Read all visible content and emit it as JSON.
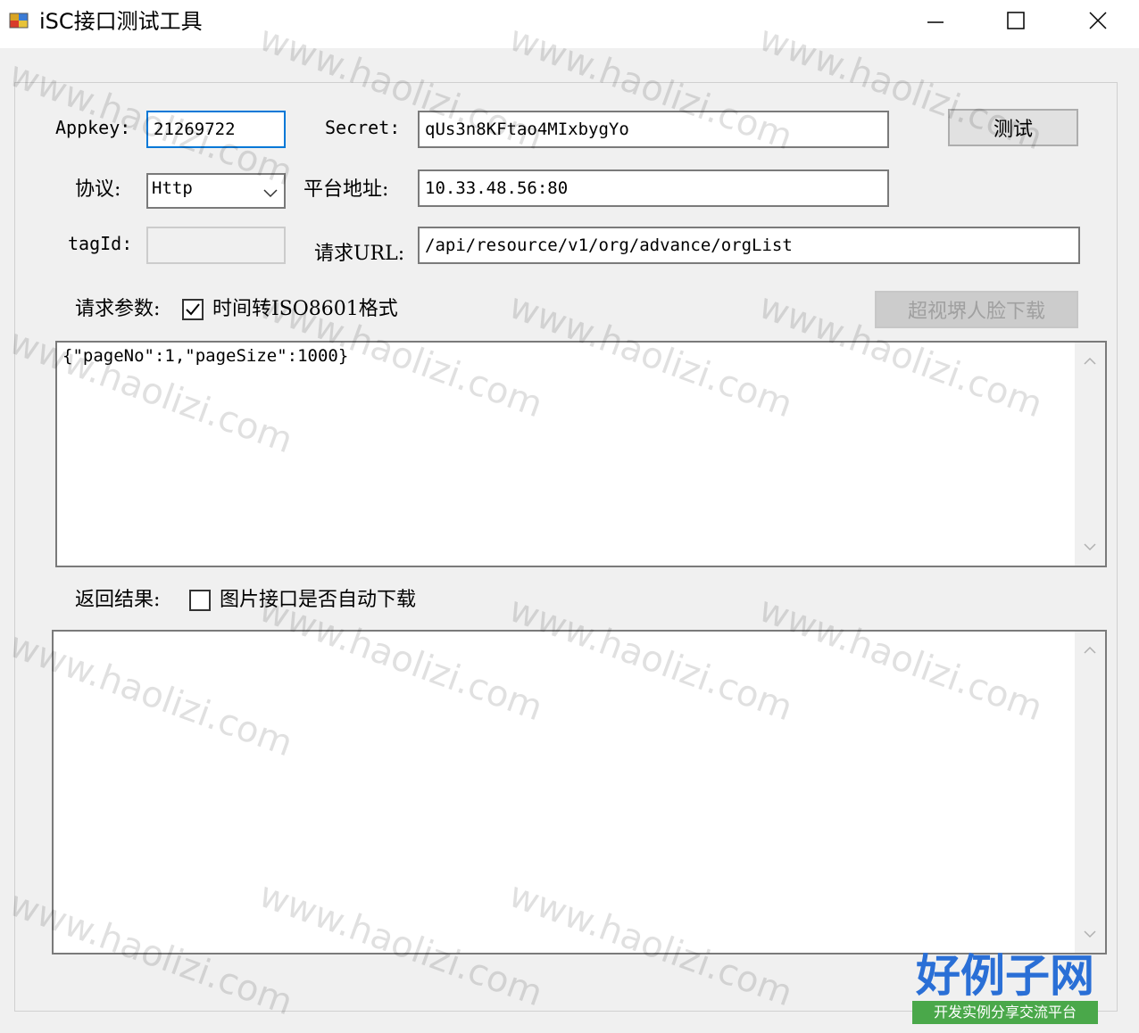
{
  "window": {
    "title": "iSC接口测试工具"
  },
  "form": {
    "appkey_label": "Appkey:",
    "appkey_value": "21269722",
    "secret_label": "Secret:",
    "secret_value": "qUs3n8KFtao4MIxbygYo",
    "test_button": "测试",
    "protocol_label": "协议:",
    "protocol_value": "Http",
    "platform_label": "平台地址:",
    "platform_value": "10.33.48.56:80",
    "tagid_label": "tagId:",
    "tagid_value": "",
    "url_label": "请求URL:",
    "url_value": "/api/resource/v1/org/advance/orgList",
    "params_label": "请求参数:",
    "iso_checkbox_label": "时间转ISO8601格式",
    "iso_checked": true,
    "face_download_button": "超视堺人脸下载",
    "params_value": "{\"pageNo\":1,\"pageSize\":1000}",
    "result_label": "返回结果:",
    "auto_download_label": "图片接口是否自动下载",
    "auto_download_checked": false,
    "result_value": ""
  },
  "watermark": {
    "text": "www.haolizi.com",
    "logo_main": "好例子网",
    "logo_sub": "开发实例分享交流平台"
  }
}
